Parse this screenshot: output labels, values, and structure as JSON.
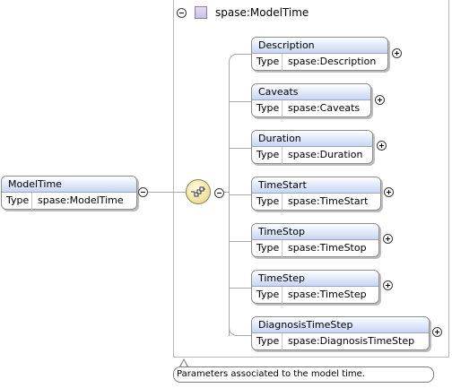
{
  "root": {
    "name": "ModelTime",
    "type_key": "Type",
    "type_value": "spase:ModelTime"
  },
  "group": {
    "title": "spase:ModelTime"
  },
  "children": [
    {
      "name": "Description",
      "type_key": "Type",
      "type_value": "spase:Description"
    },
    {
      "name": "Caveats",
      "type_key": "Type",
      "type_value": "spase:Caveats"
    },
    {
      "name": "Duration",
      "type_key": "Type",
      "type_value": "spase:Duration"
    },
    {
      "name": "TimeStart",
      "type_key": "Type",
      "type_value": "spase:TimeStart"
    },
    {
      "name": "TimeStop",
      "type_key": "Type",
      "type_value": "spase:TimeStop"
    },
    {
      "name": "TimeStep",
      "type_key": "Type",
      "type_value": "spase:TimeStep"
    },
    {
      "name": "DiagnosisTimeStep",
      "type_key": "Type",
      "type_value": "spase:DiagnosisTimeStep"
    }
  ],
  "tooltip": {
    "text": "Parameters associated to the model time."
  },
  "colors": {
    "header_gradient_bottom": "#c6d5f2",
    "sequence_fill": "#f2e4a4",
    "complex_type_icon": "#cbbfe3"
  }
}
